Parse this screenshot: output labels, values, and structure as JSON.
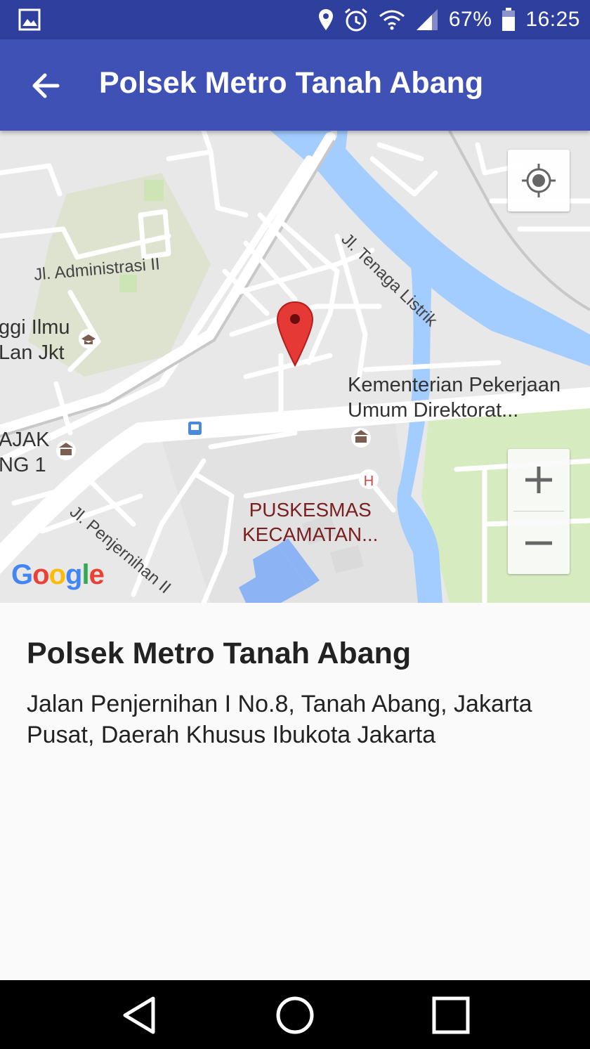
{
  "status_bar": {
    "battery": "67%",
    "time": "16:25",
    "icons": [
      "gallery-icon",
      "location-icon",
      "alarm-icon",
      "wifi-icon",
      "signal-icon",
      "battery-icon"
    ]
  },
  "app_bar": {
    "title": "Polsek Metro Tanah Abang",
    "back_icon": "arrow-left-icon",
    "color": "#3f51b5"
  },
  "map": {
    "street_labels": {
      "administrasi": "Jl. Administrasi II",
      "tenaga": "Jl. Tenaga Listrik",
      "penjernihan": "Jl. Penjernihan II"
    },
    "place_labels": {
      "tinggi": "ggi Ilmu\nLan Jkt",
      "kementerian": "Kementerian Pekerjaan\nUmum Direktorat...",
      "pajak": "AJAK\nNG 1",
      "puskesmas": "PUSKESMAS\nKECAMATAN..."
    },
    "zoom_in": "+",
    "zoom_out": "−",
    "logo": "Google",
    "marker_color": "#e53935",
    "water_color": "#a3ccff",
    "park_color": "#d6ecc0"
  },
  "place": {
    "name": "Polsek Metro Tanah Abang",
    "address": "Jalan Penjernihan I No.8, Tanah Abang, Jakarta Pusat, Daerah Khusus Ibukota Jakarta"
  },
  "nav_bar": {
    "icons": [
      "back-triangle-icon",
      "home-circle-icon",
      "recents-square-icon"
    ]
  }
}
